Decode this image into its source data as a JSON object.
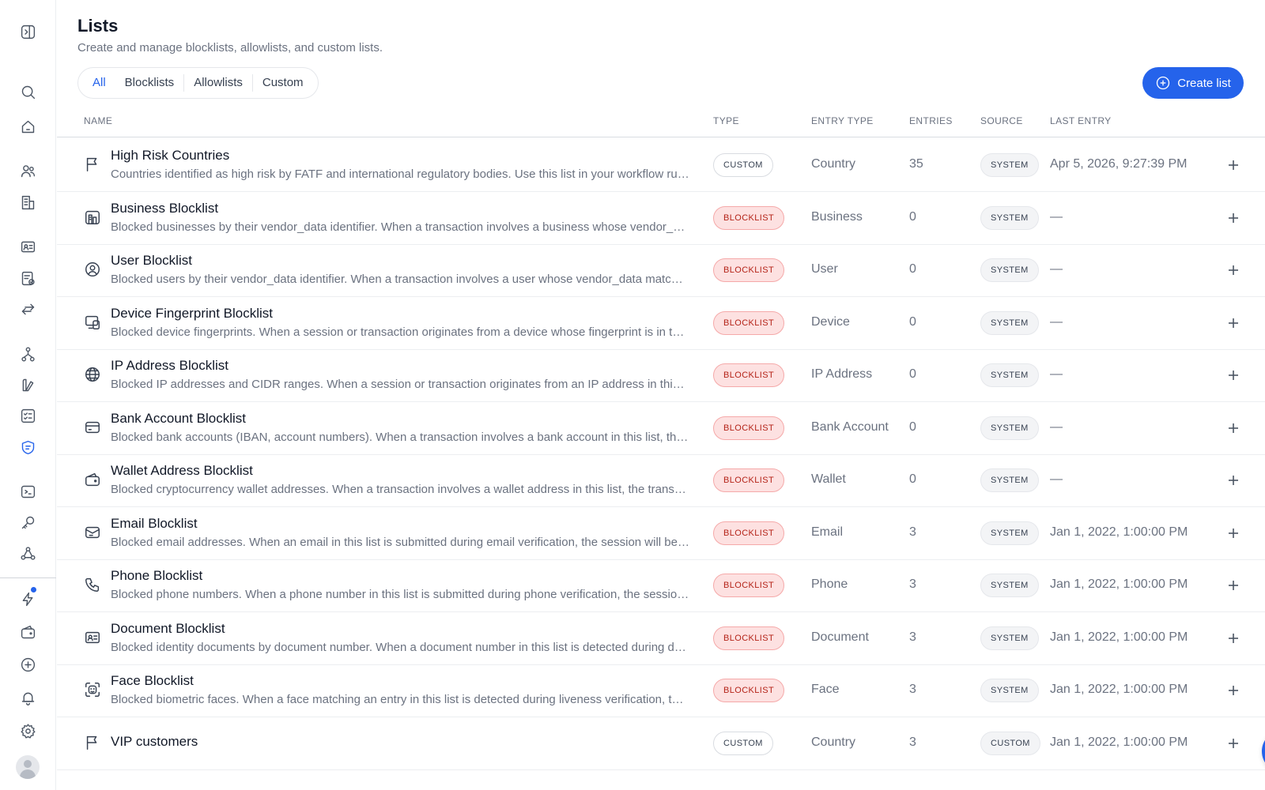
{
  "page": {
    "title": "Lists",
    "subtitle": "Create and manage blocklists, allowlists, and custom lists."
  },
  "tabs": [
    {
      "label": "All",
      "active": true
    },
    {
      "label": "Blocklists",
      "active": false
    },
    {
      "label": "Allowlists",
      "active": false
    },
    {
      "label": "Custom",
      "active": false
    }
  ],
  "create_button": {
    "label": "Create list"
  },
  "columns": {
    "name": "NAME",
    "type": "TYPE",
    "entry_type": "ENTRY TYPE",
    "entries": "ENTRIES",
    "source": "SOURCE",
    "last_entry": "LAST ENTRY"
  },
  "rows": [
    {
      "icon": "flag-icon",
      "name": "High Risk Countries",
      "description": "Countries identified as high risk by FATF and international regulatory bodies. Use this list in your workflow rules to flag or block users from these countries.",
      "type": "CUSTOM",
      "entry_type": "Country",
      "entries": "35",
      "source": "SYSTEM",
      "last_entry": "Apr 5, 2026, 9:27:39 PM"
    },
    {
      "icon": "building-icon",
      "name": "Business Blocklist",
      "description": "Blocked businesses by their vendor_data identifier. When a transaction involves a business whose vendor_data matches an entry in this list, the transaction is blocked.",
      "type": "BLOCKLIST",
      "entry_type": "Business",
      "entries": "0",
      "source": "SYSTEM",
      "last_entry": "—"
    },
    {
      "icon": "user-circle-icon",
      "name": "User Blocklist",
      "description": "Blocked users by their vendor_data identifier. When a transaction involves a user whose vendor_data matches an entry in this list, the transaction is blocked.",
      "type": "BLOCKLIST",
      "entry_type": "User",
      "entries": "0",
      "source": "SYSTEM",
      "last_entry": "—"
    },
    {
      "icon": "devices-icon",
      "name": "Device Fingerprint Blocklist",
      "description": "Blocked device fingerprints. When a session or transaction originates from a device whose fingerprint is in this list, it is blocked.",
      "type": "BLOCKLIST",
      "entry_type": "Device",
      "entries": "0",
      "source": "SYSTEM",
      "last_entry": "—"
    },
    {
      "icon": "globe-icon",
      "name": "IP Address Blocklist",
      "description": "Blocked IP addresses and CIDR ranges. When a session or transaction originates from an IP address in this list, it is blocked.",
      "type": "BLOCKLIST",
      "entry_type": "IP Address",
      "entries": "0",
      "source": "SYSTEM",
      "last_entry": "—"
    },
    {
      "icon": "bank-card-icon",
      "name": "Bank Account Blocklist",
      "description": "Blocked bank accounts (IBAN, account numbers). When a transaction involves a bank account in this list, the transaction is blocked.",
      "type": "BLOCKLIST",
      "entry_type": "Bank Account",
      "entries": "0",
      "source": "SYSTEM",
      "last_entry": "—"
    },
    {
      "icon": "wallet-icon",
      "name": "Wallet Address Blocklist",
      "description": "Blocked cryptocurrency wallet addresses. When a transaction involves a wallet address in this list, the transaction is blocked.",
      "type": "BLOCKLIST",
      "entry_type": "Wallet",
      "entries": "0",
      "source": "SYSTEM",
      "last_entry": "—"
    },
    {
      "icon": "mail-icon",
      "name": "Email Blocklist",
      "description": "Blocked email addresses. When an email in this list is submitted during email verification, the session will be declined.",
      "type": "BLOCKLIST",
      "entry_type": "Email",
      "entries": "3",
      "source": "SYSTEM",
      "last_entry": "Jan 1, 2022, 1:00:00 PM"
    },
    {
      "icon": "phone-icon",
      "name": "Phone Blocklist",
      "description": "Blocked phone numbers. When a phone number in this list is submitted during phone verification, the session will be declined.",
      "type": "BLOCKLIST",
      "entry_type": "Phone",
      "entries": "3",
      "source": "SYSTEM",
      "last_entry": "Jan 1, 2022, 1:00:00 PM"
    },
    {
      "icon": "id-card-icon",
      "name": "Document Blocklist",
      "description": "Blocked identity documents by document number. When a document number in this list is detected during document verification, the session will be declined.",
      "type": "BLOCKLIST",
      "entry_type": "Document",
      "entries": "3",
      "source": "SYSTEM",
      "last_entry": "Jan 1, 2022, 1:00:00 PM"
    },
    {
      "icon": "face-scan-icon",
      "name": "Face Blocklist",
      "description": "Blocked biometric faces. When a face matching an entry in this list is detected during liveness verification, the session will be declined.",
      "type": "BLOCKLIST",
      "entry_type": "Face",
      "entries": "3",
      "source": "SYSTEM",
      "last_entry": "Jan 1, 2022, 1:00:00 PM"
    },
    {
      "icon": "flag-icon",
      "name": "VIP customers",
      "description": "",
      "type": "CUSTOM",
      "entry_type": "Country",
      "entries": "3",
      "source": "CUSTOM",
      "last_entry": "Jan 1, 2022, 1:00:00 PM"
    }
  ],
  "sidebar": {
    "icons": [
      "sidebar-toggle-icon",
      "search-icon",
      "home-icon",
      "users-icon",
      "buildings-icon",
      "id-card-icon",
      "document-check-icon",
      "arrows-exchange-icon",
      "workflow-icon",
      "analytics-icon",
      "checklist-icon",
      "shield-list-icon",
      "terminal-icon",
      "key-icon",
      "webhook-icon",
      "lightning-icon",
      "wallet-icon",
      "plus-circle-icon",
      "bell-icon",
      "gear-icon"
    ]
  },
  "colors": {
    "accent": "#2563eb",
    "blocklist_bg": "#fde1e1",
    "blocklist_text": "#b42318"
  }
}
